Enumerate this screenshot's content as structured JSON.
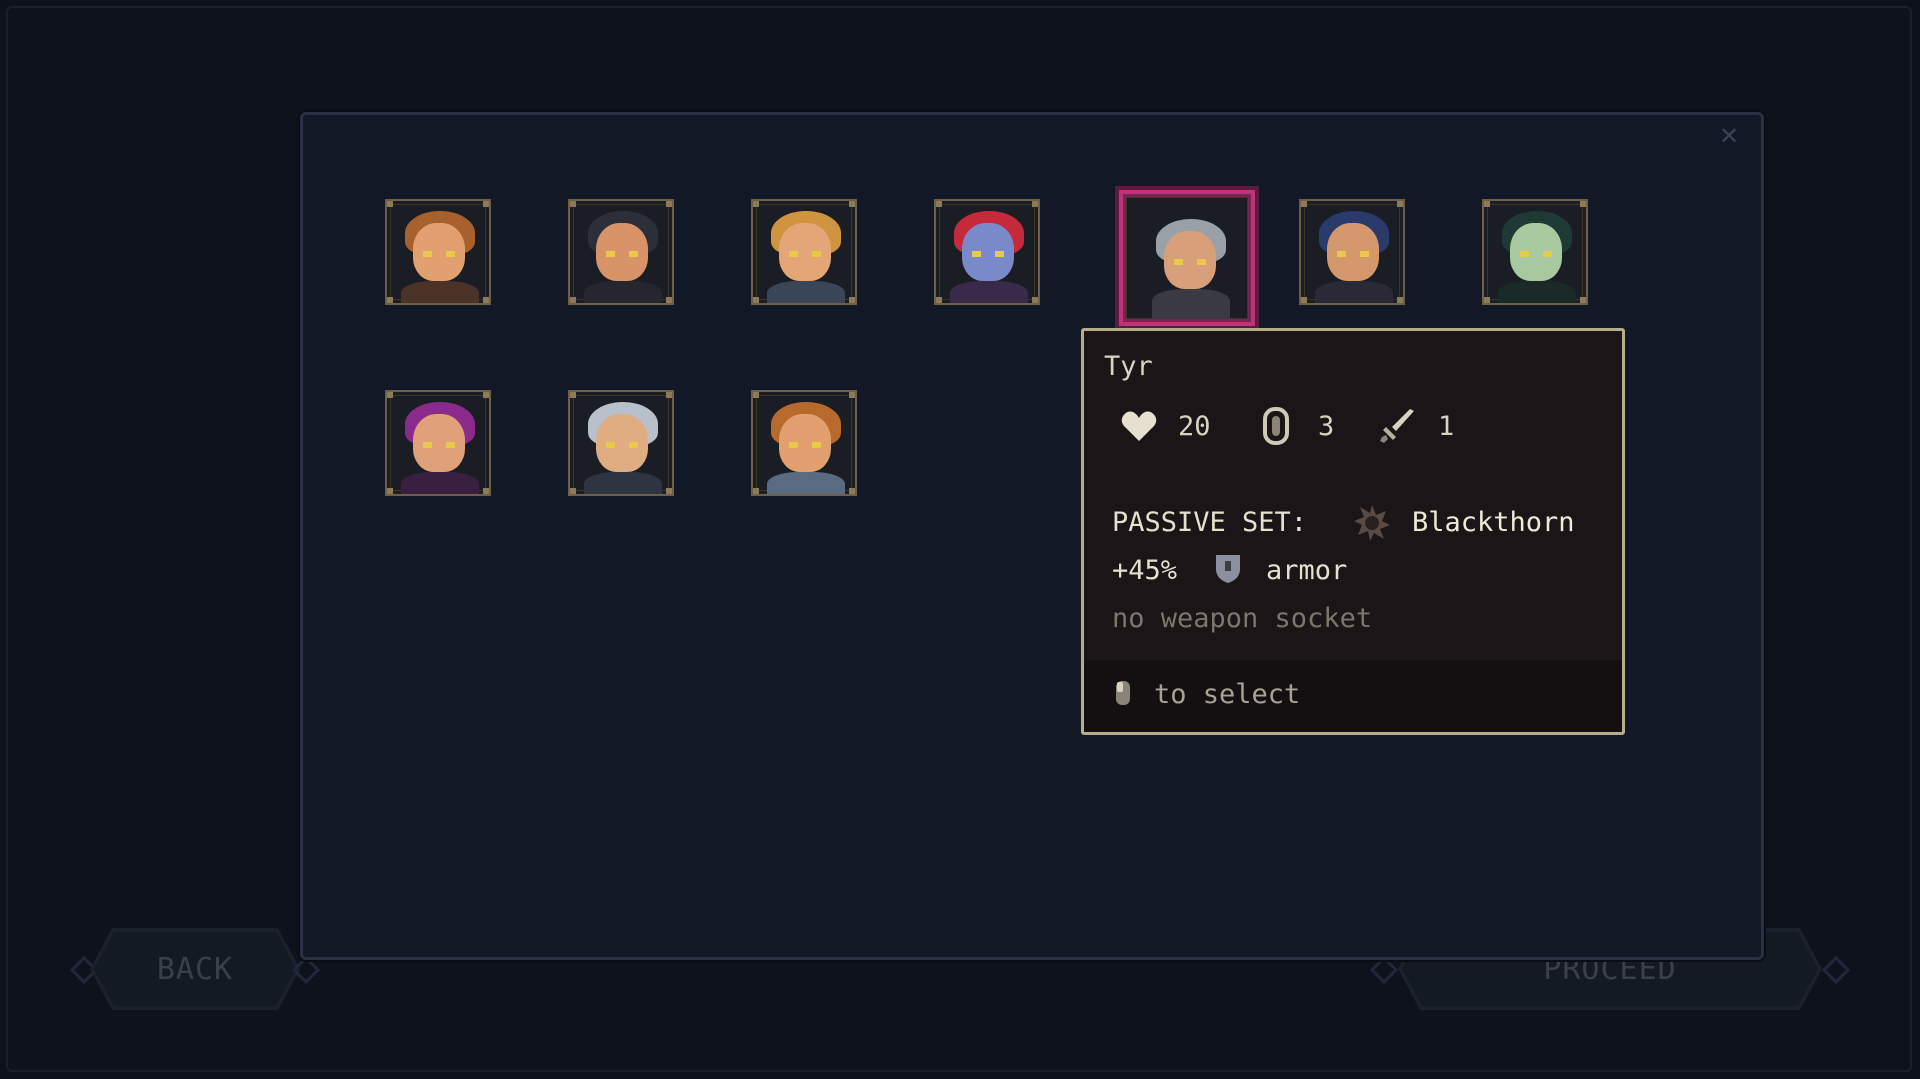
{
  "buttons": {
    "back_label": "BACK",
    "proceed_label": "PROCEED"
  },
  "panel": {
    "close_icon": "close-icon"
  },
  "characters": [
    {
      "id": "char-1",
      "hair": "#a8602c",
      "skin": "#e2a070",
      "body": "#4a3226",
      "selected": false
    },
    {
      "id": "char-2",
      "hair": "#2c2f3a",
      "skin": "#d89468",
      "body": "#26262e",
      "selected": false
    },
    {
      "id": "char-3",
      "hair": "#d09440",
      "skin": "#e4a676",
      "body": "#3a4656",
      "selected": false
    },
    {
      "id": "char-4",
      "hair": "#c42a3a",
      "skin": "#7a8ac8",
      "body": "#3a2a4a",
      "selected": false
    },
    {
      "id": "char-5",
      "hair": "#9aa0a8",
      "skin": "#d8a07a",
      "body": "#3a3a42",
      "selected": true
    },
    {
      "id": "char-6",
      "hair": "#2a3a6a",
      "skin": "#d4986c",
      "body": "#2a2a36",
      "selected": false
    },
    {
      "id": "char-7",
      "hair": "#1e3a34",
      "skin": "#a8c8a0",
      "body": "#1a2a26",
      "selected": false
    },
    {
      "id": "char-8",
      "hair": "#8a2a8a",
      "skin": "#e0a07a",
      "body": "#3a2040",
      "selected": false
    },
    {
      "id": "char-9",
      "hair": "#b8c0cc",
      "skin": "#e0ac82",
      "body": "#2e3440",
      "selected": false
    },
    {
      "id": "char-10",
      "hair": "#b86a2c",
      "skin": "#e2a070",
      "body": "#5a6a80",
      "selected": false
    }
  ],
  "tooltip": {
    "name": "Tyr",
    "health": "20",
    "armor_stat": "3",
    "attack": "1",
    "passive_label": "PASSIVE SET:",
    "passive_name": "Blackthorn",
    "bonus_value": "+45%",
    "bonus_stat": "armor",
    "note": "no weapon socket",
    "select_hint": "to select"
  },
  "colors": {
    "accent_selected": "#c0327a",
    "tooltip_border": "#b7ac8c",
    "panel_border": "#283042"
  }
}
